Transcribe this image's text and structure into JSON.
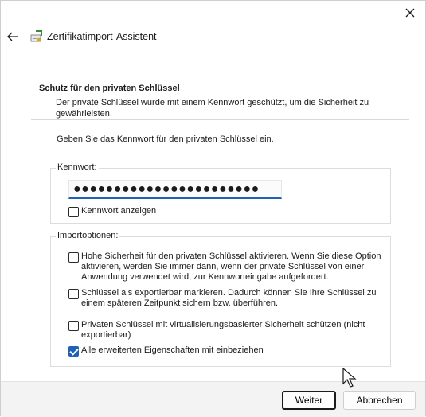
{
  "window": {
    "title": "Zertifikatimport-Assistent",
    "close_icon": "close-icon",
    "back_icon": "back-arrow-icon",
    "app_icon": "certificate-wizard-icon"
  },
  "section": {
    "title": "Schutz für den privaten Schlüssel",
    "description": "Der private Schlüssel wurde mit einem Kennwort geschützt, um die Sicherheit zu gewährleisten."
  },
  "prompt": "Geben Sie das Kennwort für den privaten Schlüssel ein.",
  "password": {
    "legend": "Kennwort:",
    "value": "●●●●●●●●●●●●●●●●●●●●●●●",
    "show_label": "Kennwort anzeigen",
    "show_checked": false
  },
  "import_options": {
    "legend": "Importoptionen:",
    "items": [
      {
        "label": "Hohe Sicherheit für den privaten Schlüssel aktivieren. Wenn Sie diese Option aktivieren, werden Sie immer dann, wenn der private Schlüssel von einer Anwendung verwendet wird, zur Kennworteingabe aufgefordert.",
        "checked": false
      },
      {
        "label": "Schlüssel als exportierbar markieren. Dadurch können Sie Ihre Schlüssel zu einem späteren Zeitpunkt sichern bzw. überführen.",
        "checked": false
      },
      {
        "label": "Privaten Schlüssel mit virtualisierungsbasierter Sicherheit schützen (nicht exportierbar)",
        "checked": false
      },
      {
        "label": "Alle erweiterten Eigenschaften mit einbeziehen",
        "checked": true
      }
    ]
  },
  "footer": {
    "next_label": "Weiter",
    "cancel_label": "Abbrechen"
  },
  "colors": {
    "accent": "#1f62b5",
    "footer_bg": "#f3f3f3"
  }
}
